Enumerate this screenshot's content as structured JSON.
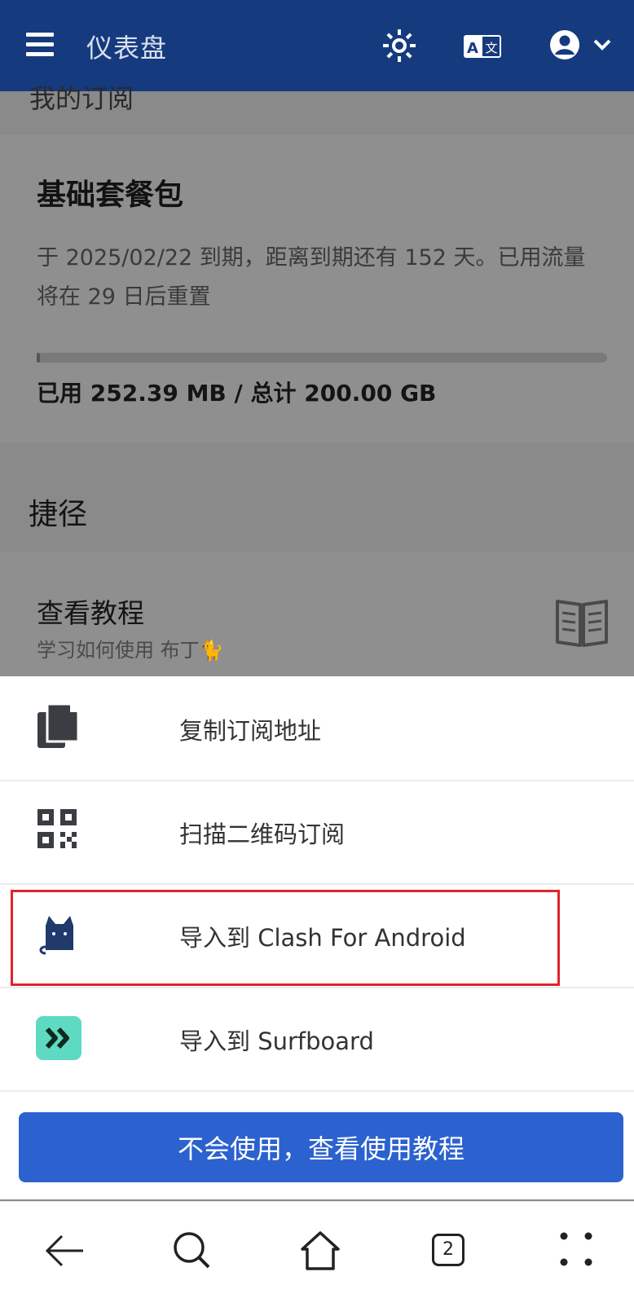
{
  "header": {
    "title": "仪表盘",
    "menu_icon": "hamburger-menu-icon",
    "theme_icon": "sun-icon",
    "language_icon": "translate-icon",
    "account_icon": "user-circle-icon",
    "dropdown_icon": "chevron-down-icon"
  },
  "dashboard": {
    "subscription_section_title": "我的订阅",
    "plan": {
      "name": "基础套餐包",
      "expiry_text": "于 2025/02/22 到期，距离到期还有 152 天。已用流量将在 29 日后重置",
      "usage_used_label": "已用",
      "usage_used": "252.39 MB",
      "usage_separator": "/",
      "usage_total_label": "总计",
      "usage_total": "200.00 GB",
      "usage_fraction": 0.0012
    },
    "shortcuts_title": "捷径",
    "tutorial": {
      "title": "查看教程",
      "subtitle": "学习如何使用 布丁🐈",
      "icon": "book-icon"
    }
  },
  "sheet": {
    "items": [
      {
        "label": "复制订阅地址",
        "icon": "copy-icon"
      },
      {
        "label": "扫描二维码订阅",
        "icon": "qr-code-icon"
      },
      {
        "label": "导入到 Clash For Android",
        "icon": "clash-cat-icon"
      },
      {
        "label": "导入到 Surfboard",
        "icon": "surfboard-icon"
      }
    ],
    "help_button": "不会使用，查看使用教程"
  },
  "navbar": {
    "tab_count": "2",
    "back_icon": "back-arrow-icon",
    "search_icon": "search-icon",
    "home_icon": "home-icon",
    "tabs_icon": "tabs-icon",
    "more_icon": "more-icon"
  },
  "colors": {
    "header_bg": "#163a7e",
    "primary": "#2b62cf",
    "highlight_border": "#e0242c",
    "surfboard_teal": "#5ed9c2",
    "clash_navy": "#1f3a6b"
  }
}
